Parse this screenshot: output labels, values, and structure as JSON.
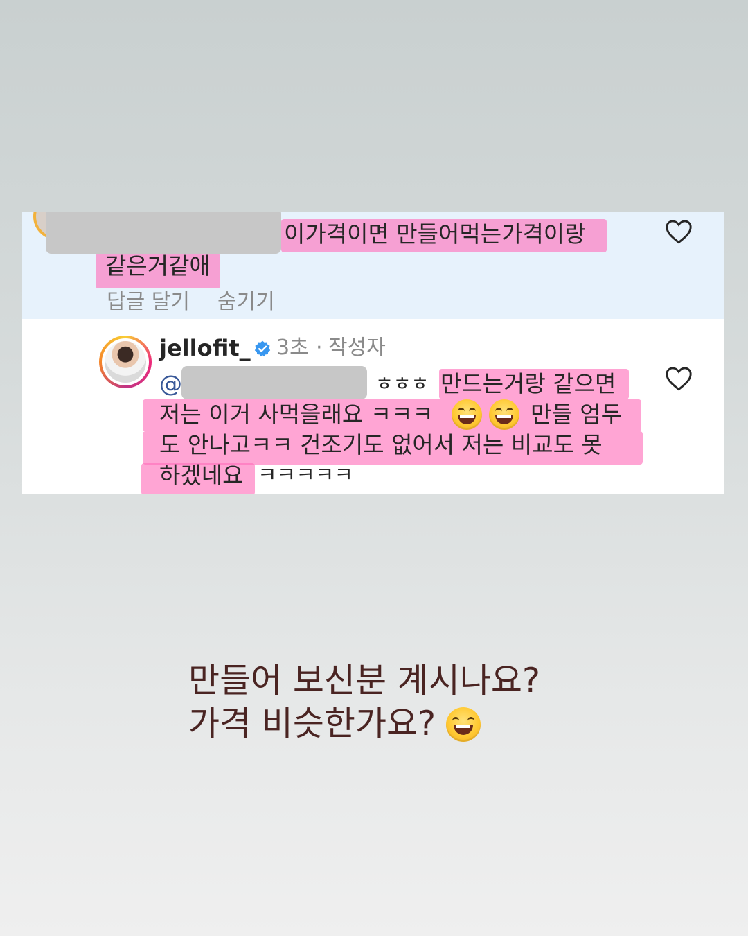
{
  "parent_comment": {
    "line1": "이가격이면 만들어먹는가격이랑",
    "line2": "같은거같애",
    "reply_label": "답글 달기",
    "hide_label": "숨기기"
  },
  "reply": {
    "username": "jellofit_",
    "time": "3초",
    "separator": "·",
    "author_label": "작성자",
    "mention": "@",
    "line1_prefix": "ㅎㅎㅎ",
    "line1_highlight": "만드는거랑 같으면",
    "line2_a": "저는 이거 사먹을래요 ㅋㅋㅋ",
    "line2_b": "만들 엄두",
    "line3": "도 안나고ㅋㅋ 건조기도 없어서 저는 비교도 못",
    "line4_a": "하겠네요",
    "line4_b": "ㅋㅋㅋㅋㅋ"
  },
  "caption": {
    "line1": "만들어 보신분 계시나요?",
    "line2": "가격 비슷한가요?"
  },
  "colors": {
    "highlight": "#ff6eb9",
    "verified": "#3897f0",
    "caption_text": "#4a2422",
    "top_card_bg": "#e7f2fc"
  },
  "icons": [
    "heart-icon",
    "verified-badge-icon",
    "grinning-squinting-face-emoji"
  ]
}
